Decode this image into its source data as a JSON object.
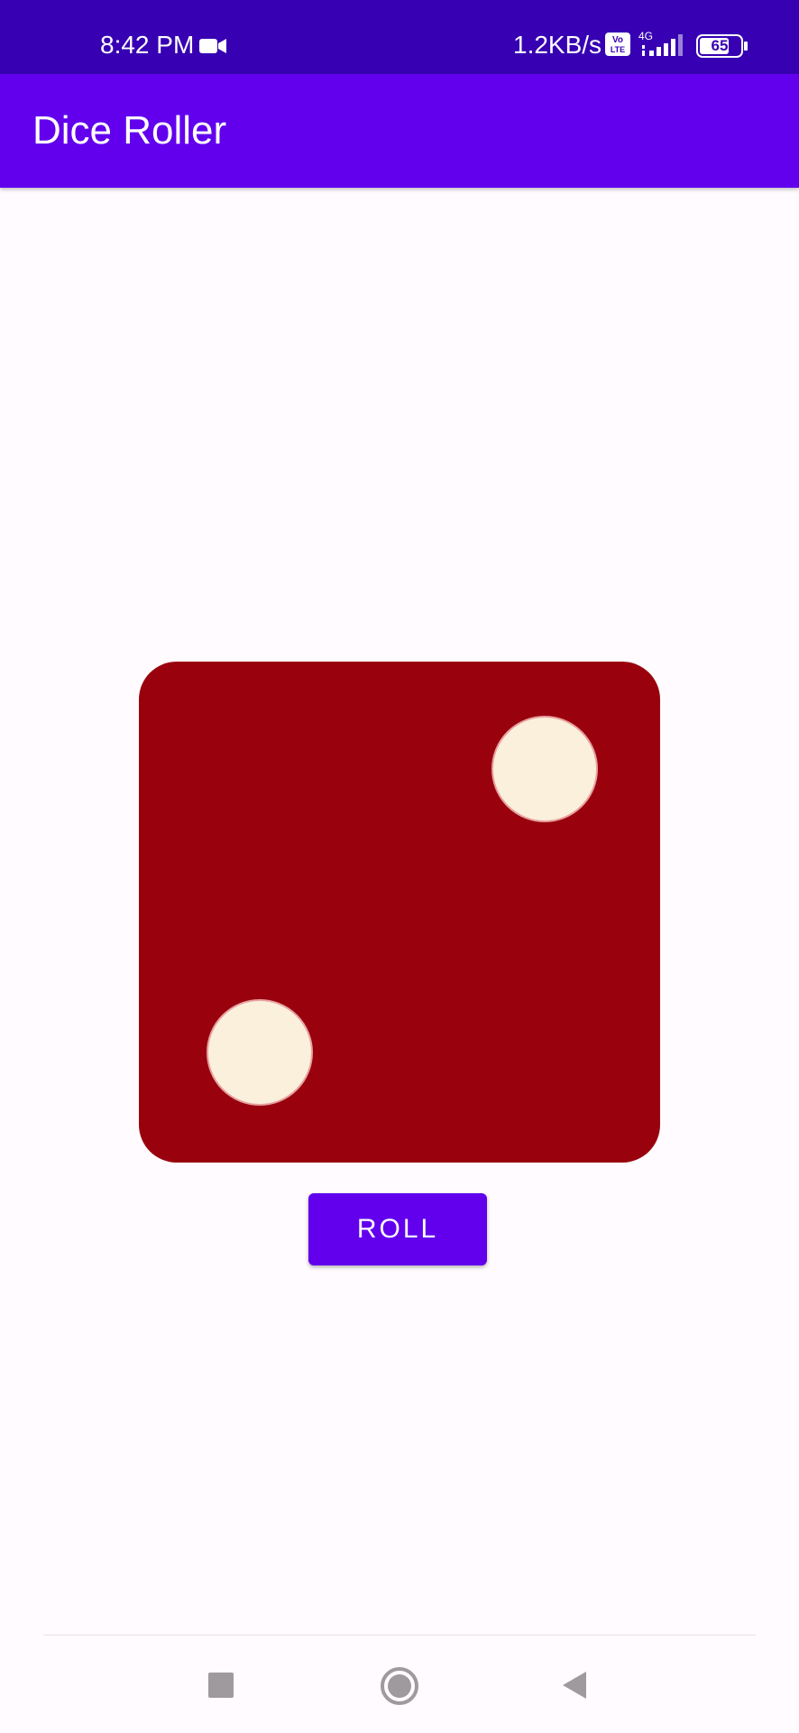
{
  "status_bar": {
    "time": "8:42 PM",
    "net_speed": "1.2KB/s",
    "network_type": "4G",
    "volte": "Vo LTE",
    "battery": "65",
    "icons": [
      "video-camera-icon",
      "volte-icon",
      "signal-icon",
      "battery-icon"
    ]
  },
  "app_bar": {
    "title": "Dice Roller"
  },
  "dice": {
    "face_value": 2,
    "body_color": "#99020d",
    "pip_color": "#faf0dc"
  },
  "roll_button": {
    "label": "ROLL"
  },
  "nav_bar": {
    "icons": [
      "recents-icon",
      "home-icon",
      "back-icon"
    ]
  },
  "colors": {
    "primary": "#6200ee",
    "primary_dark": "#3700b3",
    "background": "#fffbfe"
  }
}
